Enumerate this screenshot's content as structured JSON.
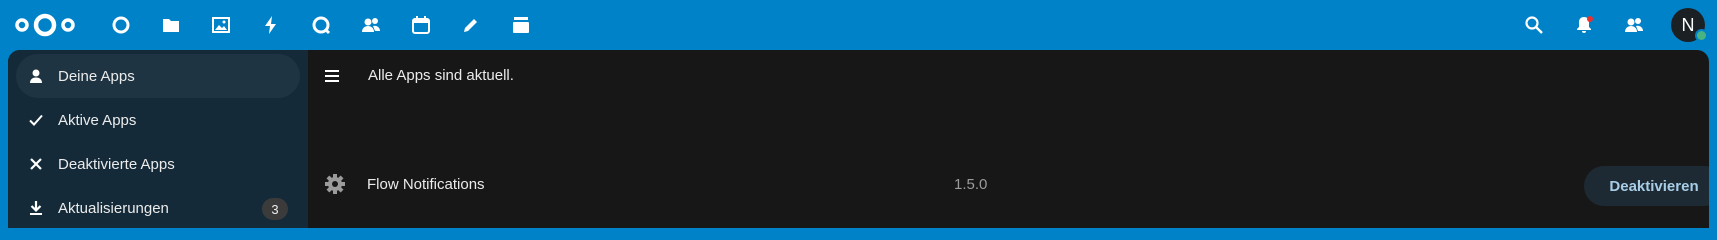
{
  "header": {
    "logo": "nextcloud-logo",
    "apps": [
      {
        "icon": "dashboard-icon"
      },
      {
        "icon": "files-icon"
      },
      {
        "icon": "photos-icon"
      },
      {
        "icon": "activity-icon"
      },
      {
        "icon": "talk-icon"
      },
      {
        "icon": "contacts-icon"
      },
      {
        "icon": "calendar-icon"
      },
      {
        "icon": "notes-icon"
      },
      {
        "icon": "deck-icon"
      }
    ],
    "right_icons": [
      "search-icon",
      "notifications-icon",
      "contacts-menu-icon"
    ],
    "avatar_initial": "N",
    "colors": {
      "brand": "#0082c9",
      "status_online": "#49b382",
      "notification_dot": "#e9322d"
    }
  },
  "sidebar": {
    "items": [
      {
        "label": "Deine Apps",
        "icon": "user-icon",
        "active": true
      },
      {
        "label": "Aktive Apps",
        "icon": "check-icon",
        "active": false
      },
      {
        "label": "Deaktivierte Apps",
        "icon": "close-icon",
        "active": false
      },
      {
        "label": "Aktualisierungen",
        "icon": "download-icon",
        "active": false,
        "badge": "3"
      }
    ]
  },
  "content": {
    "status_text": "Alle Apps sind aktuell.",
    "apps": [
      {
        "icon": "gear-icon",
        "name": "Flow Notifications",
        "version": "1.5.0",
        "action_label": "Deaktivieren"
      }
    ]
  }
}
